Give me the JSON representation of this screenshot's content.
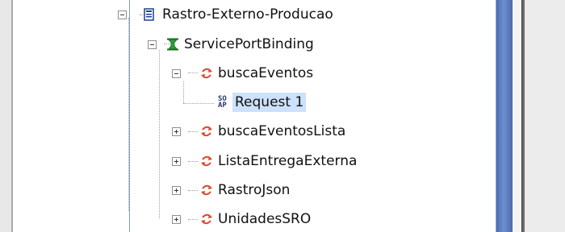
{
  "tree": {
    "project": {
      "label": "Rastro-Externo-Producao",
      "icon": "project-icon",
      "expanded": true
    },
    "binding": {
      "label": "ServicePortBinding",
      "icon": "binding-icon",
      "expanded": true
    },
    "operations": [
      {
        "label": "buscaEventos",
        "icon": "operation-icon",
        "expanded": true,
        "children": [
          {
            "label": "Request 1",
            "icon": "soap-request-icon",
            "selected": true,
            "icon_text_top": "SO",
            "icon_text_bottom": "AP"
          }
        ]
      },
      {
        "label": "buscaEventosLista",
        "icon": "operation-icon",
        "expanded": false
      },
      {
        "label": "ListaEntregaExterna",
        "icon": "operation-icon",
        "expanded": false
      },
      {
        "label": "RastroJson",
        "icon": "operation-icon",
        "expanded": false
      },
      {
        "label": "UnidadesSRO",
        "icon": "operation-icon",
        "expanded": false
      }
    ]
  },
  "colors": {
    "selection": "#cce1fb",
    "scroll_thumb": "#5b7fc0",
    "operation_icon": "#d9492b",
    "binding_icon": "#2e9e3a"
  }
}
